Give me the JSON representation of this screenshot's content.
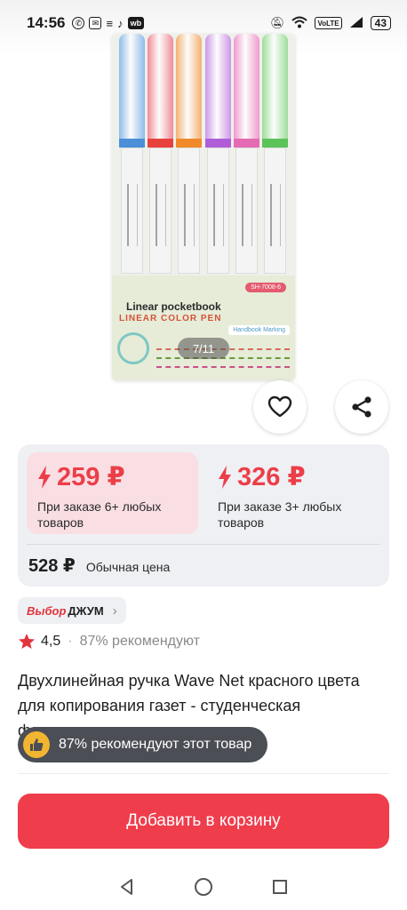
{
  "status_bar": {
    "time": "14:56",
    "left_icons": [
      "whatsapp-icon",
      "viber-icon",
      "notes-icon",
      "sound-icon",
      "wildberries-icon"
    ],
    "battery": "43",
    "volte": "VoLTE"
  },
  "gallery": {
    "pager": "7/11",
    "image": {
      "code_label": "SH-7008-6",
      "title_line1": "Linear pocketbook",
      "title_line2": "LINEAR COLOR PEN",
      "badge": "Handbook Marking",
      "pen_colors": [
        "#7fb2ea",
        "#f07a8a",
        "#f4a65c",
        "#c688e6",
        "#f08ac9",
        "#8fda8c"
      ],
      "band_colors": [
        "#4a8fd8",
        "#e8423d",
        "#f08a2a",
        "#b05ed8",
        "#e46bb3",
        "#5cc35a"
      ]
    }
  },
  "prices": {
    "deal1": {
      "amount": "259 ₽",
      "condition": "При заказе 6+ любых товаров"
    },
    "deal2": {
      "amount": "326 ₽",
      "condition": "При заказе 3+ любых товаров"
    },
    "regular": {
      "amount": "528 ₽",
      "label": "Обычная цена"
    }
  },
  "brand": {
    "prefix": "Выбор",
    "name": "ДЖУМ"
  },
  "rating": {
    "score": "4,5",
    "recommend": "87% рекомендуют"
  },
  "product_title": "Двухлинейная ручка Wave Net красного цвета для копирования газет - студенческая флуоресцентная ручка",
  "toast": {
    "text": "87% рекомендуют этот товар"
  },
  "cart_button": {
    "label": "Добавить в корзину"
  },
  "colors": {
    "accent": "#ef3d4c",
    "deal_bg": "#f9dfe3",
    "panel_bg": "#eff0f3",
    "toast_bg": "#4c4e55"
  }
}
